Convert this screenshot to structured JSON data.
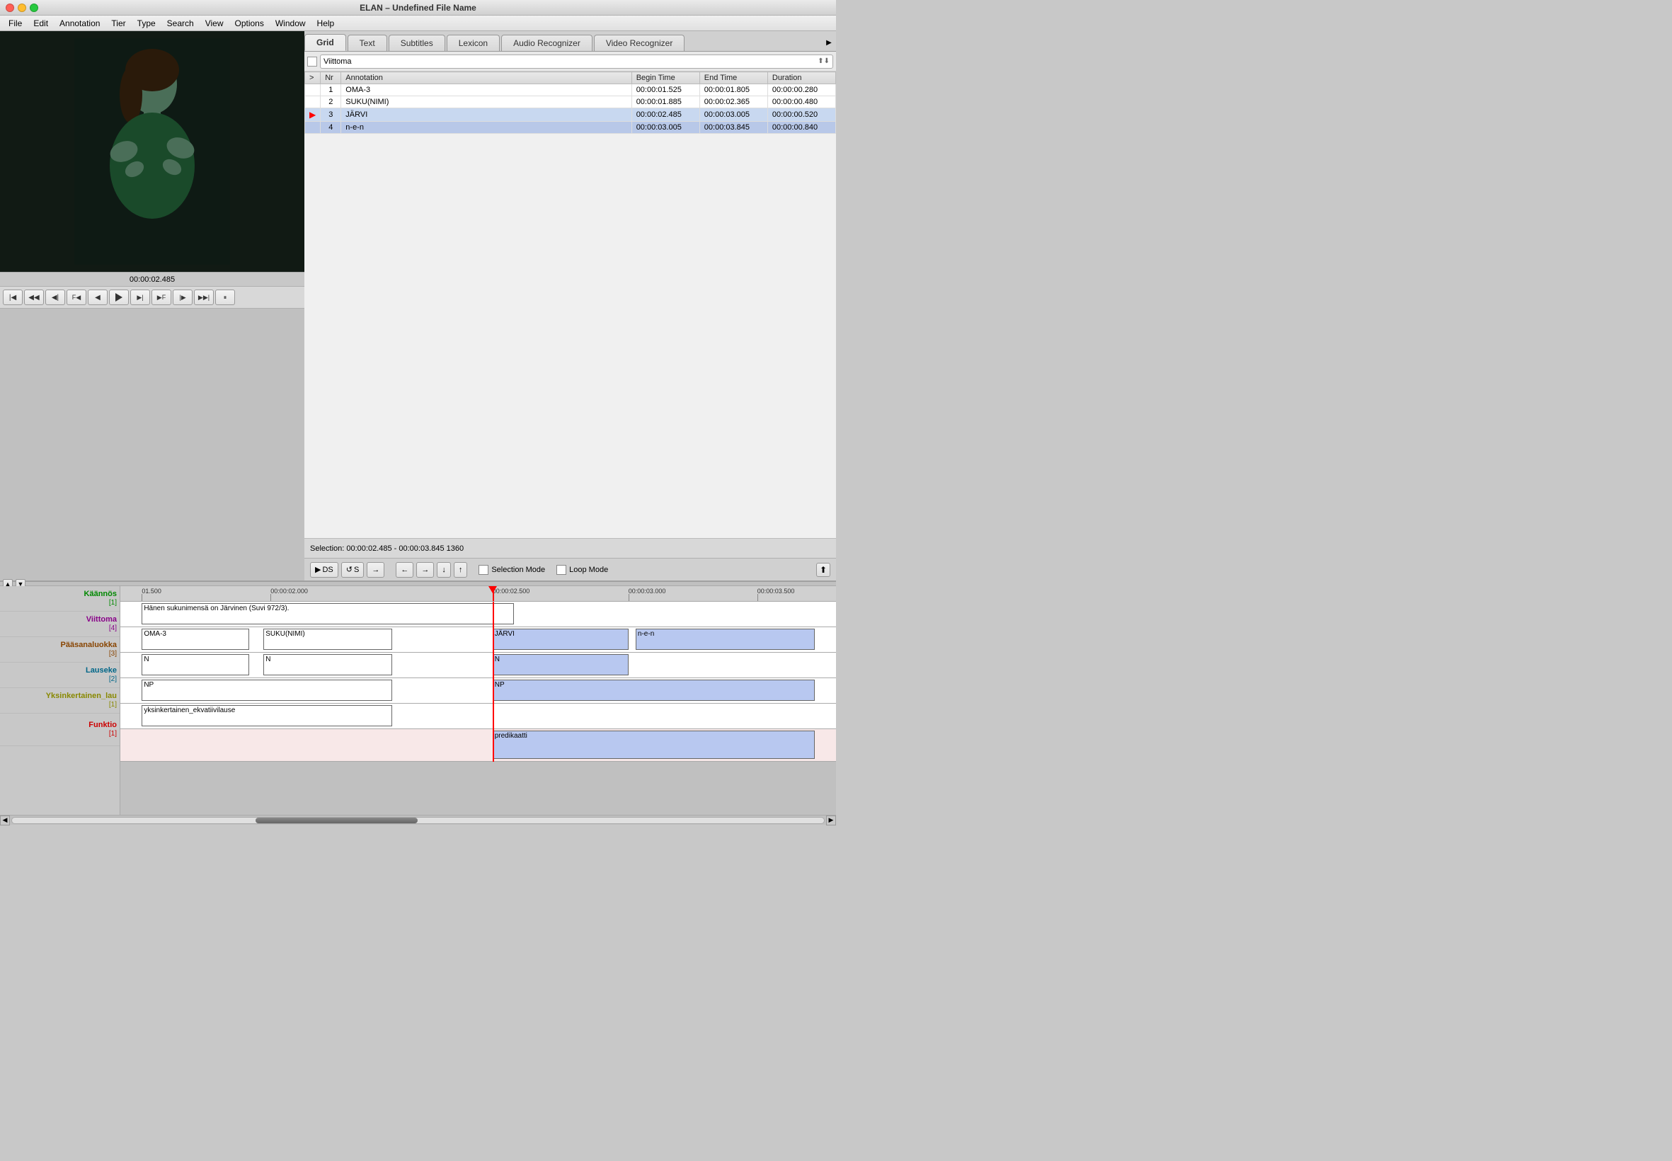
{
  "app": {
    "title": "ELAN – Undefined File Name"
  },
  "traffic_lights": {
    "red": "close",
    "yellow": "minimize",
    "green": "maximize"
  },
  "menubar": {
    "items": [
      "File",
      "Edit",
      "Annotation",
      "Tier",
      "Type",
      "Search",
      "View",
      "Options",
      "Window",
      "Help"
    ]
  },
  "video": {
    "timestamp": "00:00:02.485"
  },
  "tabs": {
    "items": [
      "Grid",
      "Text",
      "Subtitles",
      "Lexicon",
      "Audio Recognizer",
      "Video Recognizer"
    ],
    "active": "Grid"
  },
  "grid": {
    "dropdown_value": "Viittoma",
    "columns": [
      "Nr",
      "Annotation",
      "Begin Time",
      "End Time",
      "Duration"
    ],
    "rows": [
      {
        "nr": "1",
        "annotation": "OMA-3",
        "begin": "00:00:01.525",
        "end": "00:00:01.805",
        "duration": "00:00:00.280",
        "selected": false,
        "current": false
      },
      {
        "nr": "2",
        "annotation": "SUKU(NIMI)",
        "begin": "00:00:01.885",
        "end": "00:00:02.365",
        "duration": "00:00:00.480",
        "selected": false,
        "current": false
      },
      {
        "nr": "3",
        "annotation": "JÄRVI",
        "begin": "00:00:02.485",
        "end": "00:00:03.005",
        "duration": "00:00:00.520",
        "selected": true,
        "current": true
      },
      {
        "nr": "4",
        "annotation": "n-e-n",
        "begin": "00:00:03.005",
        "end": "00:00:03.845",
        "duration": "00:00:00.840",
        "selected": true,
        "current": false
      }
    ]
  },
  "selection_info": {
    "label": "Selection: 00:00:02.485 - 00:00:03.845  1360"
  },
  "transport": {
    "buttons": [
      "|◀",
      "◀◀",
      "◀|",
      "F◀",
      "◀",
      "▶",
      "▶|",
      "▶F",
      "|▶",
      "▶▶|"
    ]
  },
  "controls": {
    "ds_label": "DS",
    "s_label": "S",
    "arrow_label": "→",
    "left_arrow": "←",
    "right_arrow": "→",
    "down_arrow": "↓",
    "up_arrow": "↑",
    "selection_mode_label": "Selection Mode",
    "loop_mode_label": "Loop Mode"
  },
  "timeline": {
    "ruler_marks": [
      "01.500",
      "00:00:02.000",
      "00:00:02.500",
      "00:00:03.000",
      "00:00:03.500"
    ],
    "tracks": [
      {
        "name": "Käännös",
        "count": "[1]",
        "color": "#008800",
        "height": 36,
        "annotations": [
          {
            "label": "Hänen sukunimensä on Järvinen (Suvi 972/3).",
            "start_pct": 3,
            "width_pct": 52,
            "selected": false
          }
        ]
      },
      {
        "name": "Viittoma",
        "count": "[4]",
        "color": "#880088",
        "height": 36,
        "annotations": [
          {
            "label": "OMA-3",
            "start_pct": 3,
            "width_pct": 15,
            "selected": false
          },
          {
            "label": "SUKU(NIMI)",
            "start_pct": 20,
            "width_pct": 18,
            "selected": false
          },
          {
            "label": "JÄRVI",
            "start_pct": 52,
            "width_pct": 19,
            "selected": true
          },
          {
            "label": "n-e-n",
            "start_pct": 72,
            "width_pct": 25,
            "selected": true
          }
        ]
      },
      {
        "name": "Pääsanaluokka",
        "count": "[3]",
        "color": "#884400",
        "height": 36,
        "annotations": [
          {
            "label": "N",
            "start_pct": 3,
            "width_pct": 15,
            "selected": false
          },
          {
            "label": "N",
            "start_pct": 20,
            "width_pct": 18,
            "selected": false
          },
          {
            "label": "N",
            "start_pct": 52,
            "width_pct": 19,
            "selected": true
          }
        ]
      },
      {
        "name": "Lauseke",
        "count": "[2]",
        "color": "#006688",
        "height": 36,
        "annotations": [
          {
            "label": "NP",
            "start_pct": 3,
            "width_pct": 35,
            "selected": false
          },
          {
            "label": "NP",
            "start_pct": 52,
            "width_pct": 45,
            "selected": true
          }
        ]
      },
      {
        "name": "Yksinkertainen_lau",
        "count": "[1]",
        "color": "#888800",
        "height": 36,
        "annotations": [
          {
            "label": "yksinkertainen_ekvatiivilause",
            "start_pct": 3,
            "width_pct": 35,
            "selected": false
          }
        ]
      },
      {
        "name": "Funktio",
        "count": "[1]",
        "color": "#cc0000",
        "height": 46,
        "annotations": [
          {
            "label": "predikaatti",
            "start_pct": 52,
            "width_pct": 45,
            "selected": true
          }
        ]
      }
    ],
    "playhead_pct": 52
  }
}
